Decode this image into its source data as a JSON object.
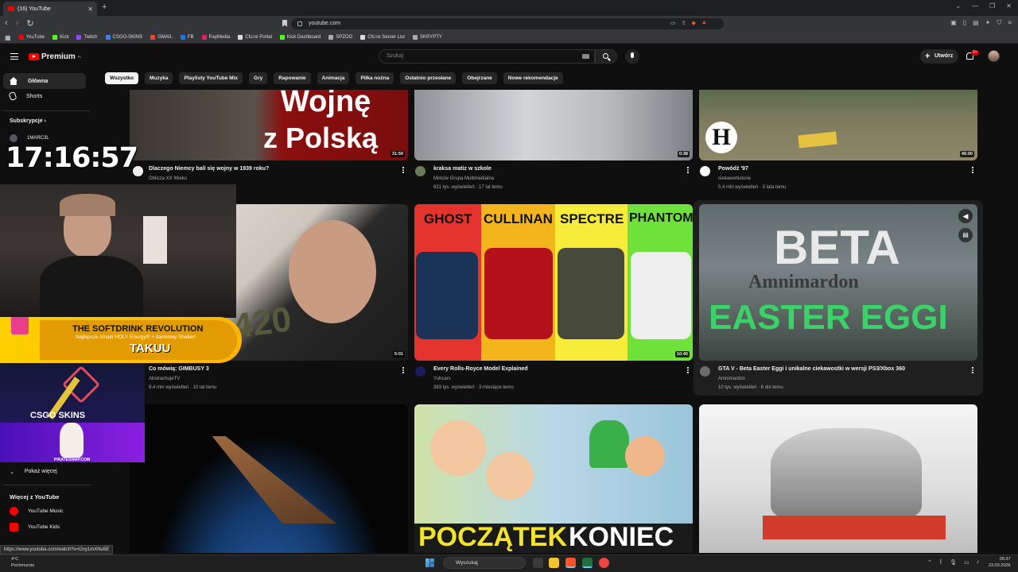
{
  "browser": {
    "tab_title": "(16) YouTube",
    "url": "youtube.com",
    "bookmarks": [
      {
        "label": "YouTube",
        "color": "#ff0000"
      },
      {
        "label": "Kick",
        "color": "#53fc18"
      },
      {
        "label": "Twitch",
        "color": "#9146ff"
      },
      {
        "label": "CSGO-SKINS",
        "color": "#3b82f6"
      },
      {
        "label": "GMAIL",
        "color": "#ea4335"
      },
      {
        "label": "FB",
        "color": "#1877f2"
      },
      {
        "label": "PayMedia",
        "color": "#e91e63"
      },
      {
        "label": "Cfu:re Portal",
        "color": "#dddddd"
      },
      {
        "label": "Kick Dashboard",
        "color": "#53fc18"
      },
      {
        "label": "SPZOO",
        "color": "#aaaaaa"
      },
      {
        "label": "Cfu:re Server List",
        "color": "#dddddd"
      },
      {
        "label": "SKRYPTY",
        "color": "#aaaaaa"
      }
    ],
    "status_url": "https://www.youtube.com/watch?v=I2xy1mXNu5E"
  },
  "header": {
    "logo_text": "Premium",
    "logo_region": "PL",
    "search_placeholder": "Szukaj",
    "create_label": "Utwórz",
    "notification_count": "9+"
  },
  "sidebar": {
    "items": [
      {
        "label": "Główna",
        "icon": "home-icon",
        "active": true
      },
      {
        "label": "Shorts",
        "icon": "shorts-icon",
        "active": false
      }
    ],
    "subscriptions_label": "Subskrypcje",
    "channels": [
      {
        "label": "1MARC3L"
      }
    ],
    "show_more_label": "Pokaż więcej",
    "more_youtube_label": "Więcej z YouTube",
    "yt_apps": [
      {
        "label": "YouTube Music",
        "icon": "youtube-music-icon"
      },
      {
        "label": "YouTube Kids",
        "icon": "youtube-kids-icon"
      }
    ]
  },
  "chips": [
    "Wszystko",
    "Muzyka",
    "Playlisty YouTube Mix",
    "Gry",
    "Rapowanie",
    "Animacja",
    "Piłka nożna",
    "Ostatnio przesłane",
    "Obejrzane",
    "Nowe rekomendacje"
  ],
  "videos": [
    {
      "title": "Dlaczego Niemcy bali się wojny w 1939 roku?",
      "channel": "Oblicza XX Wieku",
      "meta": "",
      "duration": "31:59",
      "thumb_text": [
        "Wojnę",
        "z Polską"
      ]
    },
    {
      "title": "kraksa matiz w szkole",
      "channel": "Mirków Grupa Multimedialna",
      "meta": "621 tys. wyświetleń · 17 lat temu",
      "duration": "0:38"
    },
    {
      "title": "Powódź '97",
      "channel": "ciekawehistorie",
      "meta": "5,4 mln wyświetleń · 3 lata temu",
      "duration": "46:00",
      "thumb_text": [
        "H"
      ]
    },
    {
      "title": "Co mówią: GIMBUSY 3",
      "channel": "AbstrachujeTV",
      "meta": "9,4 mln wyświetleń · 10 lat temu",
      "duration": "5:01",
      "thumb_text": [
        "420"
      ]
    },
    {
      "title": "Every Rolls-Royce Model Explained",
      "channel": "Yuhcars",
      "meta": "363 tys. wyświetleń · 3 miesiące temu",
      "duration": "10:40",
      "thumb_text": [
        "GHOST",
        "CULLINAN",
        "SPECTRE",
        "PHANTOM"
      ]
    },
    {
      "title": "GTA V - Beta Easter Eggi i unikalne ciekawostki w wersji PS3/Xbox 360",
      "channel": "Amnimardon",
      "meta": "10 tys. wyświetleń · 6 dni temu",
      "duration": "",
      "thumb_text": [
        "BETA",
        "Amnimardon",
        "EASTER EGGI"
      ]
    },
    {
      "title": "",
      "channel": "",
      "meta": "",
      "duration": ""
    },
    {
      "title": "",
      "channel": "",
      "meta": "",
      "duration": "",
      "thumb_text": [
        "POCZĄTEK",
        "KONIEC"
      ]
    },
    {
      "title": "",
      "channel": "",
      "meta": "",
      "duration": ""
    }
  ],
  "overlay": {
    "clock": "17:16:57",
    "banner_title": "THE SOFTDRINK REVOLUTION",
    "banner_sub": "Najlepsze smaki HOLY Energy® + darmowy Shaker!",
    "banner_brand": "TAKUU",
    "csgo_label": "CSGO SKINS",
    "pirate_label": "PIRATESWAP.COM"
  },
  "taskbar": {
    "weather_temp": "4°C",
    "weather_desc": "Pochmurnie",
    "search_label": "Wyszukaj",
    "time": "05:37",
    "date": "23.03.2026"
  }
}
